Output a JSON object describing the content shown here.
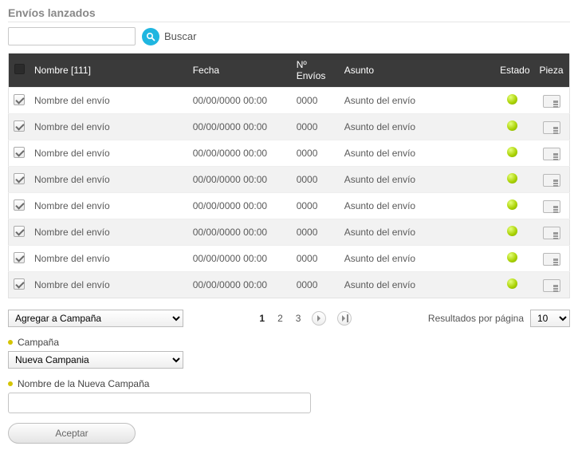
{
  "page_title": "Envíos lanzados",
  "search": {
    "placeholder": "",
    "button_label": "Buscar"
  },
  "table": {
    "headers": {
      "nombre": "Nombre [111]",
      "fecha": "Fecha",
      "envios": "Nº Envíos",
      "asunto": "Asunto",
      "estado": "Estado",
      "pieza": "Pieza"
    },
    "rows": [
      {
        "checked": true,
        "nombre": "Nombre del envío",
        "fecha": "00/00/0000 00:00",
        "envios": "0000",
        "asunto": "Asunto del envío"
      },
      {
        "checked": true,
        "nombre": "Nombre del envío",
        "fecha": "00/00/0000 00:00",
        "envios": "0000",
        "asunto": "Asunto del envío"
      },
      {
        "checked": true,
        "nombre": "Nombre del envío",
        "fecha": "00/00/0000 00:00",
        "envios": "0000",
        "asunto": "Asunto del envío"
      },
      {
        "checked": true,
        "nombre": "Nombre del envío",
        "fecha": "00/00/0000 00:00",
        "envios": "0000",
        "asunto": "Asunto del envío"
      },
      {
        "checked": true,
        "nombre": "Nombre del envío",
        "fecha": "00/00/0000 00:00",
        "envios": "0000",
        "asunto": "Asunto del envío"
      },
      {
        "checked": true,
        "nombre": "Nombre del envío",
        "fecha": "00/00/0000 00:00",
        "envios": "0000",
        "asunto": "Asunto del envío"
      },
      {
        "checked": true,
        "nombre": "Nombre del envío",
        "fecha": "00/00/0000 00:00",
        "envios": "0000",
        "asunto": "Asunto del envío"
      },
      {
        "checked": true,
        "nombre": "Nombre del envío",
        "fecha": "00/00/0000 00:00",
        "envios": "0000",
        "asunto": "Asunto del envío"
      }
    ]
  },
  "actions": {
    "bulk_select_value": "Agregar a Campaña",
    "pages": [
      "1",
      "2",
      "3"
    ],
    "active_page_index": 0,
    "results_per_page_label": "Resultados por página",
    "results_per_page_value": "10"
  },
  "campaign": {
    "label": "Campaña",
    "select_value": "Nueva Campania",
    "new_name_label": "Nombre de la Nueva Campaña",
    "new_name_value": "",
    "accept_label": "Aceptar"
  }
}
